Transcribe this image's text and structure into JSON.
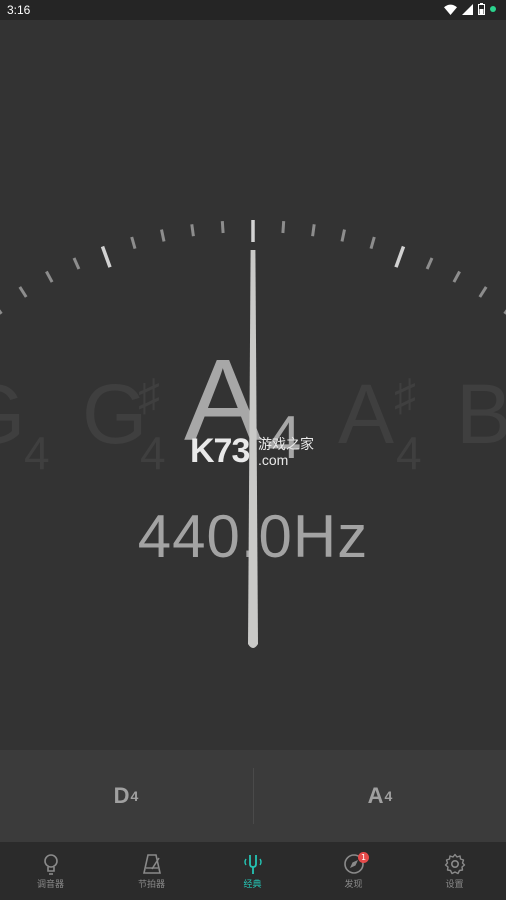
{
  "status_bar": {
    "time": "3:16"
  },
  "tuner": {
    "notes": [
      {
        "letter": "G",
        "octave": "4",
        "sharp": ""
      },
      {
        "letter": "G",
        "octave": "4",
        "sharp": "♯"
      },
      {
        "letter": "A",
        "octave": "4",
        "sharp": ""
      },
      {
        "letter": "A",
        "octave": "4",
        "sharp": "♯"
      },
      {
        "letter": "B",
        "octave": "",
        "sharp": ""
      }
    ],
    "frequency": "440.0Hz",
    "needle_deflection": 0
  },
  "watermark": {
    "logo": "K73",
    "cn": "游戏之家",
    "domain": ".com"
  },
  "strings": [
    {
      "note": "D",
      "octave": "4"
    },
    {
      "note": "A",
      "octave": "4"
    }
  ],
  "tabs": [
    {
      "label": "调音器",
      "icon": "lightbulb-icon"
    },
    {
      "label": "节拍器",
      "icon": "metronome-icon"
    },
    {
      "label": "经典",
      "icon": "tuning-fork-icon"
    },
    {
      "label": "发现",
      "icon": "compass-icon",
      "badge": "1"
    },
    {
      "label": "设置",
      "icon": "gear-icon"
    }
  ],
  "colors": {
    "accent": "#25c4b4",
    "badge": "#e64a4a",
    "background": "#333333"
  }
}
